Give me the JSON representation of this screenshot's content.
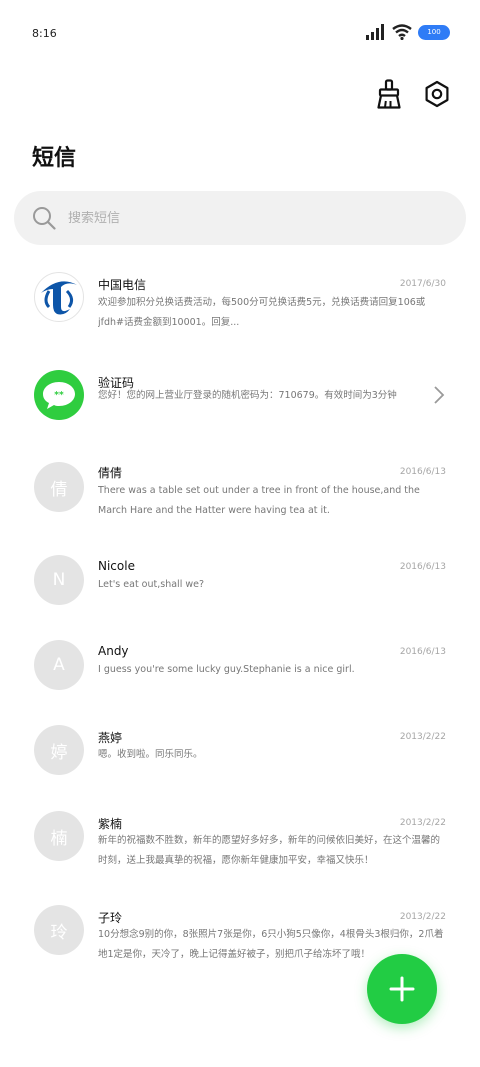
{
  "status_bar": {
    "time": "8:16",
    "battery": "100"
  },
  "header": {
    "title": "短信"
  },
  "search": {
    "placeholder": "搜索短信"
  },
  "conversations": [
    {
      "name": "中国电信",
      "date": "2017/6/30",
      "preview": "欢迎参加积分兑换话费活动，每500分可兑换话费5元，兑换话费请回复106或jfdh#话费金额到10001。回复...",
      "avatar_icon": "china-telecom-logo-icon"
    },
    {
      "name": "验证码",
      "preview": "您好！您的网上营业厅登录的随机密码为：710679。有效时间为3分钟",
      "avatar_icon": "message-bubble-icon",
      "avatar_text": "**"
    },
    {
      "name": "倩倩",
      "date": "2016/6/13",
      "preview": "There was a table set out under a tree in front of the house,and the March Hare and the Hatter were having tea at it.",
      "avatar_text": "倩"
    },
    {
      "name": "Nicole",
      "date": "2016/6/13",
      "preview": "Let's eat out,shall we?",
      "avatar_text": "N"
    },
    {
      "name": "Andy",
      "date": "2016/6/13",
      "preview": "I guess you're some lucky guy.Stephanie is a nice girl.",
      "avatar_text": "A"
    },
    {
      "name": "燕婷",
      "date": "2013/2/22",
      "preview": "嗯。收到啦。同乐同乐。",
      "avatar_text": "婷"
    },
    {
      "name": "紫楠",
      "date": "2013/2/22",
      "preview": "新年的祝福数不胜数，新年的愿望好多好多，新年的问候依旧美好，在这个温馨的时刻，送上我最真挚的祝福，愿你新年健康加平安，幸福又快乐！",
      "avatar_text": "楠"
    },
    {
      "name": "子玲",
      "date": "2013/2/22",
      "preview": "10分想念9别的你，8张照片7张是你，6只小狗5只像你，4根骨头3根归你，2爪着地1定是你，天冷了，晚上记得盖好被子，别把爪子给冻坏了哦！",
      "avatar_text": "玲"
    }
  ],
  "colors": {
    "accent": "#22cc44",
    "battery": "#2f7cf6"
  }
}
